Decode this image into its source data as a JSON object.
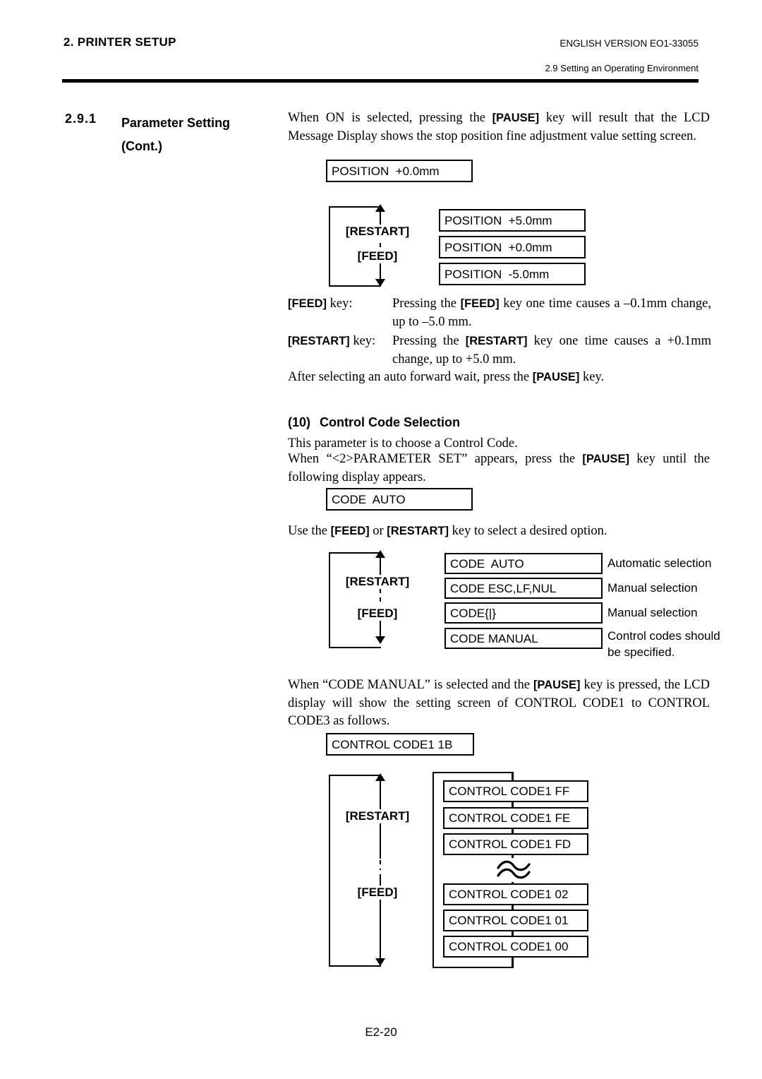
{
  "header": {
    "left": "2. PRINTER SETUP",
    "right_version": "ENGLISH VERSION EO1-33055",
    "right_section": "2.9 Setting an Operating Environment"
  },
  "section": {
    "number": "2.9.1",
    "title_line1": "Parameter Setting",
    "title_line2": "(Cont.)"
  },
  "intro": {
    "t1": "When ON is selected, pressing the ",
    "k1": "[PAUSE]",
    "t2": " key will result that the LCD Message Display shows the stop position fine adjustment value setting screen."
  },
  "lcd_position_initial": "POSITION  +0.0mm",
  "flow_position": {
    "restart_label": "[RESTART]",
    "feed_label": "[FEED]",
    "options": [
      "POSITION  +5.0mm",
      "POSITION  +0.0mm",
      "POSITION  -5.0mm"
    ]
  },
  "key_desc": {
    "feed_key": "[FEED]",
    "feed_key_suffix": " key:",
    "feed_t1": "Pressing the ",
    "feed_k": "[FEED]",
    "feed_t2": " key one time causes a –0.1mm change, up to –5.0 mm.",
    "restart_key": "[RESTART]",
    "restart_key_suffix": " key:",
    "restart_t1": "Pressing the ",
    "restart_k": "[RESTART]",
    "restart_t2": " key one time causes a +0.1mm change, up to +5.0 mm."
  },
  "after_para": {
    "t1": "After selecting an auto forward wait, press the ",
    "k1": "[PAUSE]",
    "t2": " key."
  },
  "item10": {
    "number": "(10)",
    "title": "Control Code Selection",
    "p1": "This parameter is to choose a Control Code.",
    "p2_t1": "When “<2>PARAMETER SET” appears, press the ",
    "p2_k": "[PAUSE]",
    "p2_t2": " key until the following display appears."
  },
  "lcd_code_initial": "CODE  AUTO",
  "use_line": {
    "t1": "Use the ",
    "k1": "[FEED]",
    "t2": " or ",
    "k2": "[RESTART]",
    "t3": " key to select a desired option."
  },
  "flow_code": {
    "restart_label": "[RESTART]",
    "feed_label": "[FEED]",
    "options": [
      {
        "lcd": "CODE  AUTO",
        "note": "Automatic selection"
      },
      {
        "lcd": "CODE ESC,LF,NUL",
        "note": "Manual selection"
      },
      {
        "lcd": "CODE{|}",
        "note": "Manual selection"
      },
      {
        "lcd": "CODE MANUAL",
        "note": "Control codes should\nbe specified."
      }
    ]
  },
  "manual_para": {
    "t1": "When “CODE MANUAL” is selected and the ",
    "k1": "[PAUSE]",
    "t2": " key is pressed, the LCD display will show the setting screen of CONTROL CODE1 to CONTROL CODE3 as follows."
  },
  "lcd_ctrl_initial": "CONTROL CODE1 1B",
  "flow_ctrl": {
    "restart_label": "[RESTART]",
    "feed_label": "[FEED]",
    "options_top": [
      "CONTROL CODE1 FF",
      "CONTROL CODE1 FE",
      "CONTROL CODE1 FD"
    ],
    "break_symbol": "≈",
    "options_bottom": [
      "CONTROL CODE1 02",
      "CONTROL CODE1 01",
      "CONTROL CODE1 00"
    ]
  },
  "footer": "E2-20"
}
